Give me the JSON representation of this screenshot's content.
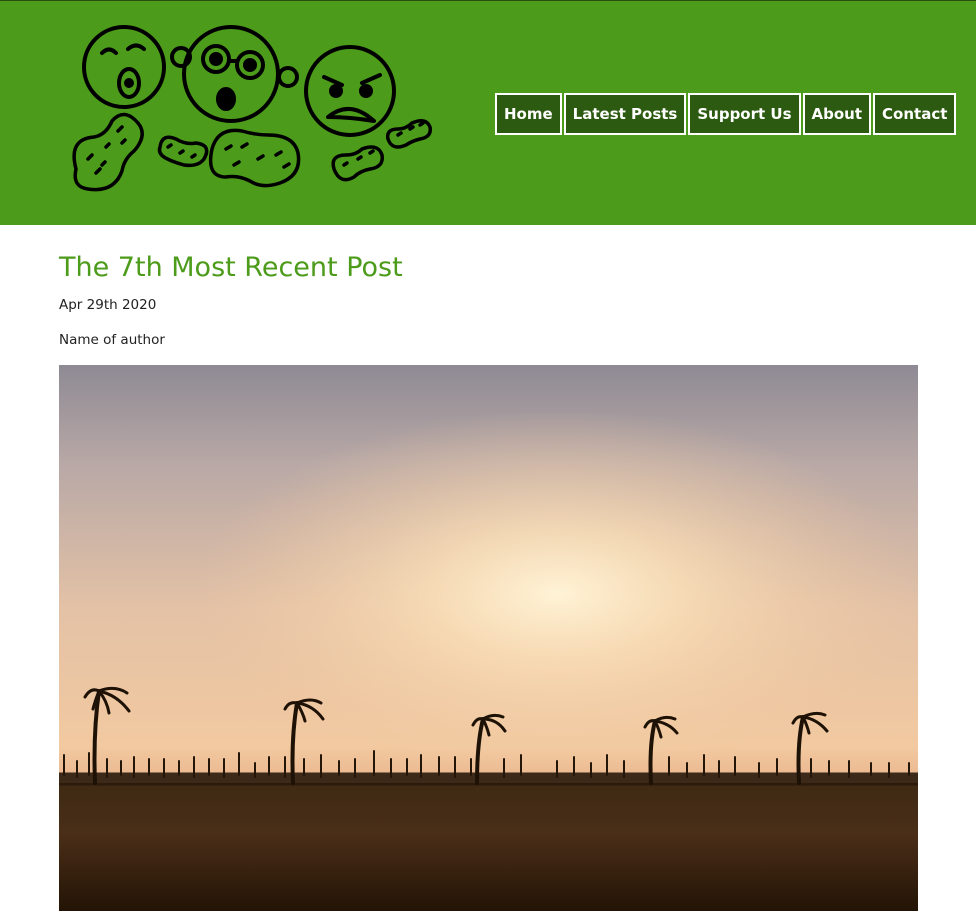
{
  "nav": {
    "items": [
      {
        "label": "Home"
      },
      {
        "label": "Latest Posts"
      },
      {
        "label": "Support Us"
      },
      {
        "label": "About"
      },
      {
        "label": "Contact"
      }
    ]
  },
  "post": {
    "title": "The 7th Most Recent Post",
    "date": "Apr 29th 2020",
    "author": "Name of author"
  },
  "colors": {
    "header_bg": "#4c9b1a",
    "nav_bg": "#2c5a10",
    "title": "#4c9b1a"
  },
  "icons": {
    "logo": "peanut-faces-logo",
    "hero": "sunset-palm-trees-photo"
  }
}
